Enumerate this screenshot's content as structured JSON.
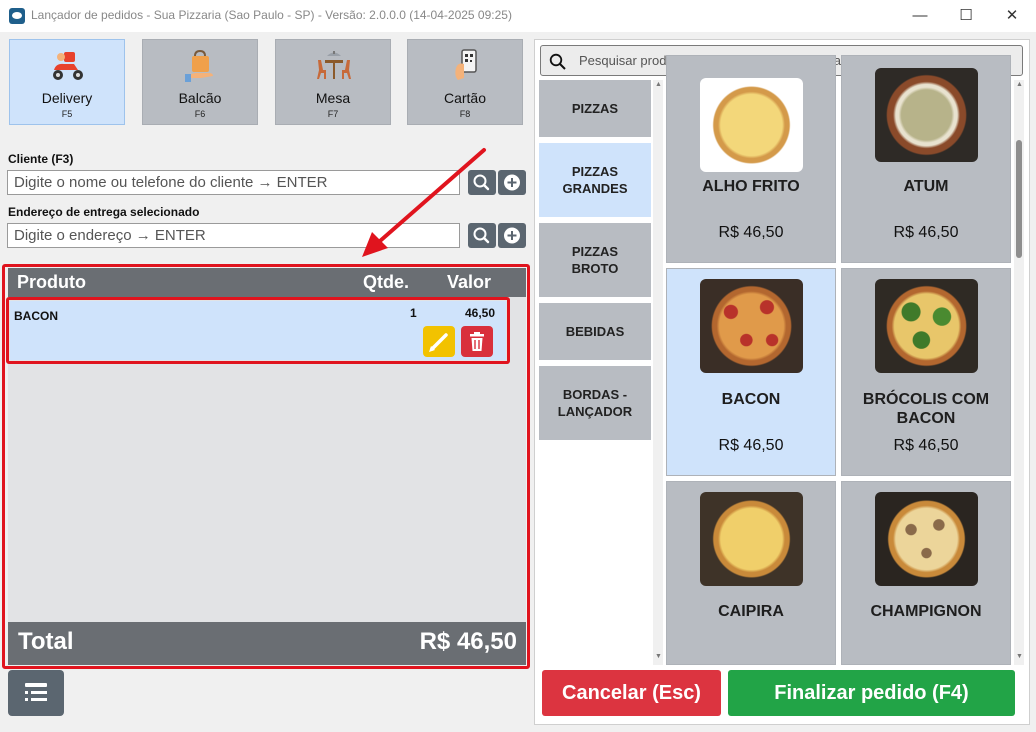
{
  "window": {
    "title": "Lançador de pedidos - Sua Pizzaria (Sao Paulo - SP) - Versão: 2.0.0.0 (14-04-2025 09:25)",
    "minimize": "—",
    "maximize": "☐",
    "close": "✕"
  },
  "order_types": [
    {
      "label": "Delivery",
      "key": "F5",
      "icon": "delivery-scooter-icon",
      "active": true
    },
    {
      "label": "Balcão",
      "key": "F6",
      "icon": "takeaway-bag-icon",
      "active": false
    },
    {
      "label": "Mesa",
      "key": "F7",
      "icon": "table-chairs-icon",
      "active": false
    },
    {
      "label": "Cartão",
      "key": "F8",
      "icon": "qr-card-icon",
      "active": false
    }
  ],
  "customer": {
    "label": "Cliente (F3)",
    "placeholder": "Digite o nome ou telefone do cliente → ENTER"
  },
  "address": {
    "label": "Endereço de entrega selecionado",
    "placeholder": "Digite o endereço → ENTER"
  },
  "order": {
    "headers": {
      "product": "Produto",
      "qty": "Qtde.",
      "value": "Valor"
    },
    "items": [
      {
        "name": "BACON",
        "qty": "1",
        "value": "46,50"
      }
    ],
    "total_label": "Total",
    "total_value": "R$ 46,50"
  },
  "search": {
    "placeholder": "Pesquisar produto (ou / + ordem da categoria → Enter)"
  },
  "categories": [
    {
      "label": "PIZZAS",
      "active": false
    },
    {
      "label": "PIZZAS GRANDES",
      "active": true
    },
    {
      "label": "PIZZAS BROTO",
      "active": false
    },
    {
      "label": "BEBIDAS",
      "active": false
    },
    {
      "label": "BORDAS - LANÇADOR",
      "active": false
    }
  ],
  "products": [
    {
      "name": "ALHO FRITO",
      "price": "R$ 46,50",
      "active": false
    },
    {
      "name": "ATUM",
      "price": "R$ 46,50",
      "active": false
    },
    {
      "name": "BACON",
      "price": "R$ 46,50",
      "active": true
    },
    {
      "name": "BRÓCOLIS COM BACON",
      "price": "R$ 46,50",
      "active": false
    },
    {
      "name": "CAIPIRA",
      "price": "",
      "active": false
    },
    {
      "name": "CHAMPIGNON",
      "price": "",
      "active": false
    }
  ],
  "actions": {
    "cancel": "Cancelar (Esc)",
    "finish": "Finalizar pedido (F4)"
  },
  "colors": {
    "highlight_red": "#e0141e",
    "cancel": "#dc3440",
    "finish": "#22a447",
    "active_tile": "#cfe3fb",
    "tile": "#b8bcc2",
    "edit_yellow": "#f2c200",
    "delete_red": "#d9303c"
  }
}
